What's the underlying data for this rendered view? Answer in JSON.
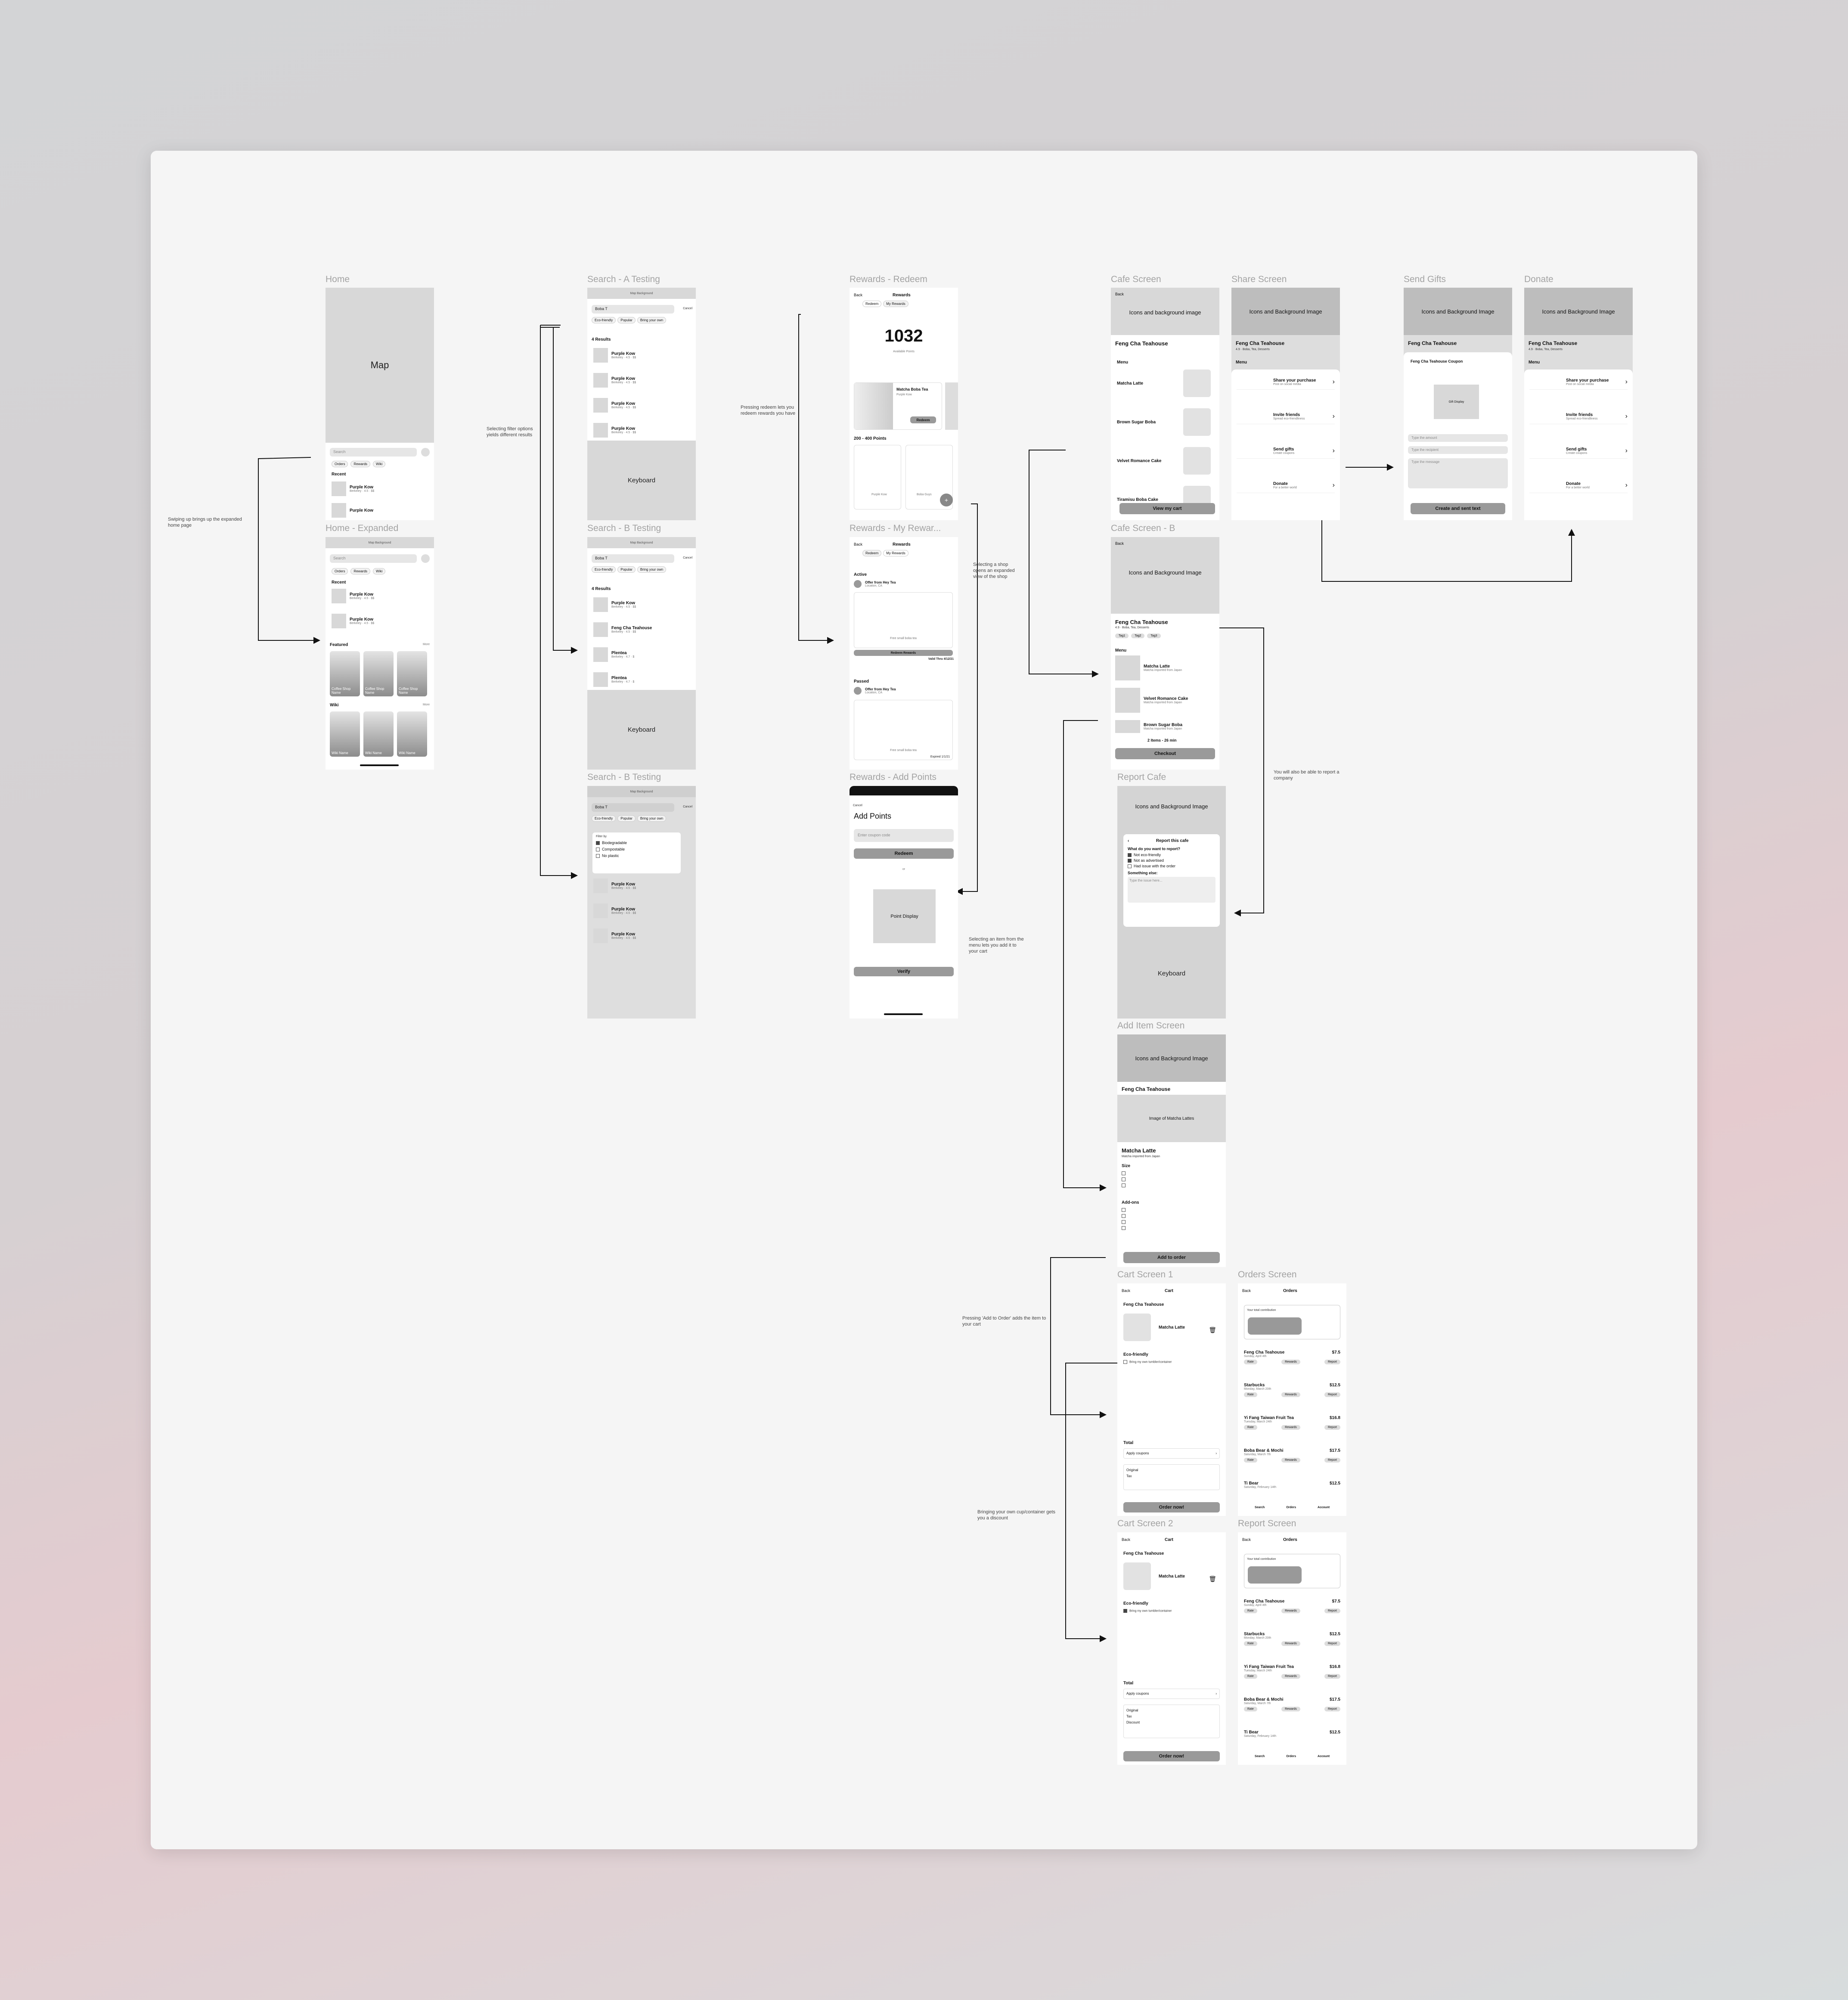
{
  "notes": {
    "swipe": "Swiping up brings up the expanded home page",
    "filter": "Selecting filter options yields different results",
    "redeem": "Pressing redeem lets you redeem rewards you have",
    "shop": "Selecting a shop opens an expanded view of the shop",
    "report": "You will also be able to report a company",
    "item": "Selecting an item from the menu lets you add it to your cart",
    "add": "Pressing 'Add to Order' adds the item to your cart",
    "cup": "Bringing your own cup/container gets you a discount"
  },
  "home": {
    "title": "Home",
    "map": "Map",
    "search": "Search",
    "tabs": [
      "Orders",
      "Rewards",
      "Wiki"
    ],
    "recent": "Recent",
    "item": "Purple Kow",
    "meta": "Berkeley · 4.5 · $$"
  },
  "home_exp": {
    "title": "Home - Expanded",
    "bg": "Map Background",
    "featured": "Featured",
    "wiki": "Wiki",
    "more": "More",
    "coffee": "Coffee Shop Name",
    "wiki_name": "Wiki Name"
  },
  "searchA": {
    "title": "Search - A Testing",
    "bg": "Map Background",
    "query": "Boba T",
    "cancel": "Cancel",
    "filters": [
      "Eco-friendly",
      "Popular",
      "Bring your own"
    ],
    "results": "4 Results",
    "items": [
      "Purple Kow",
      "Purple Kow",
      "Purple Kow",
      "Purple Kow"
    ],
    "meta": "Berkeley · 4.5 · $$",
    "keyboard": "Keyboard"
  },
  "searchB": {
    "title": "Search - B Testing",
    "results": "4 Results",
    "items": [
      "Purple Kow",
      "Feng Cha Teahouse",
      "Plentea",
      "Plentea"
    ],
    "meta2": "Berkeley · 4.7 · $"
  },
  "searchB2": {
    "title": "Search - B Testing",
    "filter_by": "Filter by",
    "options": [
      "Biodegradable",
      "Compostable",
      "No plastic"
    ],
    "items": [
      "Purple Kow",
      "Purple Kow",
      "Purple Kow"
    ]
  },
  "rewards": {
    "title": "Rewards - Redeem",
    "back": "Back",
    "header": "Rewards",
    "tabs": [
      "Redeem",
      "My Rewards"
    ],
    "points": "1032",
    "available": "Available Points",
    "item": "Matcha Boba Tea",
    "from": "Purple Kow",
    "redeem": "Redeem",
    "range": "200 - 400 Points",
    "p1": "Purple Kow",
    "p2": "Boba Guys"
  },
  "myrewards": {
    "title": "Rewards - My Rewar...",
    "active": "Active",
    "offer": "Offer from Hey Tea",
    "loc": "Location, CA",
    "free": "Free small boba tea",
    "redeemed": "Redeem Rewards",
    "valid": "Valid Thru 4/12/21",
    "passed": "Passed",
    "expired": "Expired 1/1/21"
  },
  "addpoints": {
    "title": "Rewards - Add Points",
    "cancel": "Cancel",
    "header": "Add Points",
    "placeholder": "Enter coupon code",
    "redeem": "Redeem",
    "or": "or",
    "display": "Point Display",
    "verify": "Verify"
  },
  "cafe": {
    "title": "Cafe Screen",
    "back": "Back",
    "img": "Icons and background image",
    "name": "Feng Cha Teahouse",
    "menu": "Menu",
    "items": [
      "Matcha Latte",
      "Brown Sugar Boba",
      "Velvet Romance Cake",
      "Tiramisu Boba Cake"
    ],
    "cart": "View my cart"
  },
  "cafeB": {
    "title": "Cafe Screen - B",
    "img": "Icons and Background Image",
    "meta": "4.9 · Boba, Tea, Desserts",
    "tags": [
      "Tag1",
      "Tag2",
      "Tag3"
    ],
    "items": [
      "Matcha Latte",
      "Velvet Romance Cake",
      "Brown Sugar Boba"
    ],
    "desc": "Matcha imported from Japan",
    "summary": "2 Items - 26 min",
    "checkout": "Checkout"
  },
  "share": {
    "title": "Share Screen",
    "img": "Icons and Background Image",
    "meta": "4.9 · Boba, Tea, Desserts",
    "menu": "Menu",
    "options": [
      {
        "t": "Share your purchase",
        "s": "Post on social media"
      },
      {
        "t": "Invite friends",
        "s": "Spread eco-friendliness"
      },
      {
        "t": "Send gifts",
        "s": "Create coupons"
      },
      {
        "t": "Donate",
        "s": "For a better world"
      }
    ]
  },
  "gifts": {
    "title": "Send Gifts",
    "coupon": "Feng Cha Teahouse Coupon",
    "gift": "Gift Display",
    "f1": "Type the amount",
    "f2": "Type the recipient",
    "f3": "Type the message",
    "btn": "Create and sent text"
  },
  "donate": {
    "title": "Donate"
  },
  "reportcafe": {
    "title": "Report Cafe",
    "heading": "Report this cafe",
    "q": "What do you want to report?",
    "opts": [
      "Not eco-friendly",
      "Not as advertised",
      "Had issue with the order"
    ],
    "else": "Something else:",
    "ph": "Type the issue here..."
  },
  "additem": {
    "title": "Add Item Screen",
    "img": "Image of Matcha Lattes",
    "size": "Size",
    "addons": "Add-ons",
    "btn": "Add to order"
  },
  "cart1": {
    "title": "Cart Screen 1",
    "header": "Cart",
    "eco": "Eco-friendly",
    "own": "Bring my own tumbler/container",
    "total": "Total",
    "coupon": "Apply coupons",
    "orig": "Original",
    "tax": "Tax",
    "btn": "Order now!"
  },
  "cart2": {
    "title": "Cart Screen 2",
    "discount": "Discount"
  },
  "orders": {
    "title": "Orders Screen",
    "header": "Orders",
    "contrib": "Your total contribution",
    "rows": [
      {
        "n": "Feng Cha Teahouse",
        "p": "$7.5",
        "d": "Sunday, April 4th"
      },
      {
        "n": "Starbucks",
        "p": "$12.5",
        "d": "Monday, March 20th"
      },
      {
        "n": "Yi Fang Taiwan Fruit Tea",
        "p": "$16.8",
        "d": "Tuesday, March 24th"
      },
      {
        "n": "Boba Bear & Mochi",
        "p": "$17.5",
        "d": "Saturday, March 7th"
      },
      {
        "n": "Ti Bear",
        "p": "$12.5",
        "d": "Saturday, February 14th"
      }
    ],
    "tags": [
      "Rate",
      "Rewards",
      "Report"
    ],
    "nav": [
      "Search",
      "Orders",
      "Account"
    ]
  },
  "reportscr": {
    "title": "Report Screen"
  }
}
